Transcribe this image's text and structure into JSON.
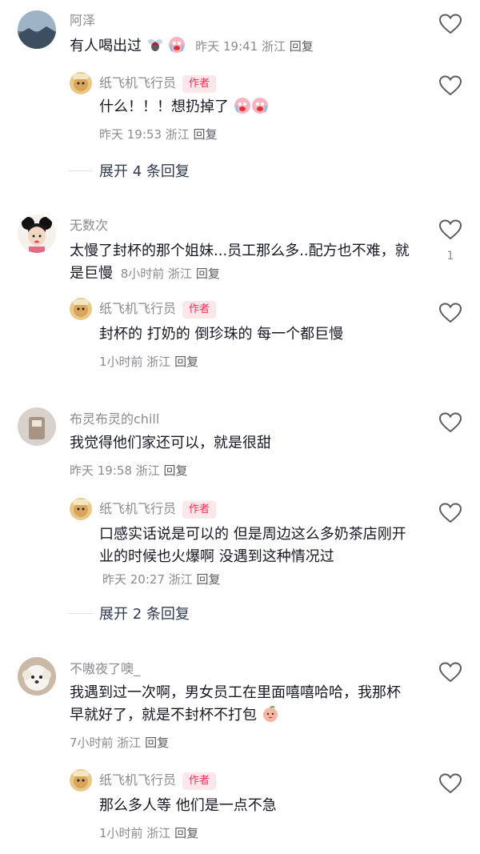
{
  "comments": [
    {
      "username": "阿泽",
      "text": "有人喝出过",
      "meta": "昨天 19:41 浙江",
      "reply_label": "回复",
      "like_count": "",
      "reply": {
        "username": "纸飞机飞行员",
        "author_tag": "作者",
        "text": "什么！！！想扔掉了",
        "meta": "昨天 19:53 浙江",
        "reply_label": "回复"
      },
      "expand": "展开 4 条回复"
    },
    {
      "username": "无数次",
      "text": "太慢了封杯的那个姐妹...员工那么多..配方也不难，就是巨慢",
      "meta": "8小时前 浙江",
      "reply_label": "回复",
      "like_count": "1",
      "reply": {
        "username": "纸飞机飞行员",
        "author_tag": "作者",
        "text": "封杯的 打奶的 倒珍珠的 每一个都巨慢",
        "meta": "1小时前 浙江",
        "reply_label": "回复"
      }
    },
    {
      "username": "布灵布灵的chill",
      "text": "我觉得他们家还可以，就是很甜",
      "meta": "昨天 19:58 浙江",
      "reply_label": "回复",
      "like_count": "",
      "reply": {
        "username": "纸飞机飞行员",
        "author_tag": "作者",
        "text": "口感实话说是可以的 但是周边这么多奶茶店刚开业的时候也火爆啊 没遇到这种情况过",
        "meta": "昨天 20:27 浙江",
        "reply_label": "回复"
      },
      "expand": "展开 2 条回复"
    },
    {
      "username": "不嗷夜了噢_",
      "text": "我遇到过一次啊，男女员工在里面嘻嘻哈哈，我那杯早就好了，就是不封杯不打包",
      "meta": "7小时前 浙江",
      "reply_label": "回复",
      "like_count": "",
      "reply": {
        "username": "纸飞机飞行员",
        "author_tag": "作者",
        "text": "那么多人等 他们是一点不急",
        "meta": "1小时前 浙江",
        "reply_label": "回复"
      }
    }
  ],
  "icons": {
    "like": "heart-outline-icon",
    "emoji_fly": "fly-emoji-icon",
    "emoji_cry": "crying-emoji-icon",
    "emoji_peach": "peach-emoji-icon"
  },
  "colors": {
    "author_tag_bg": "#fde7eb",
    "author_tag_text": "#fe2c55",
    "secondary_text": "#8a8b91",
    "expand_text": "#2f3a4f"
  }
}
